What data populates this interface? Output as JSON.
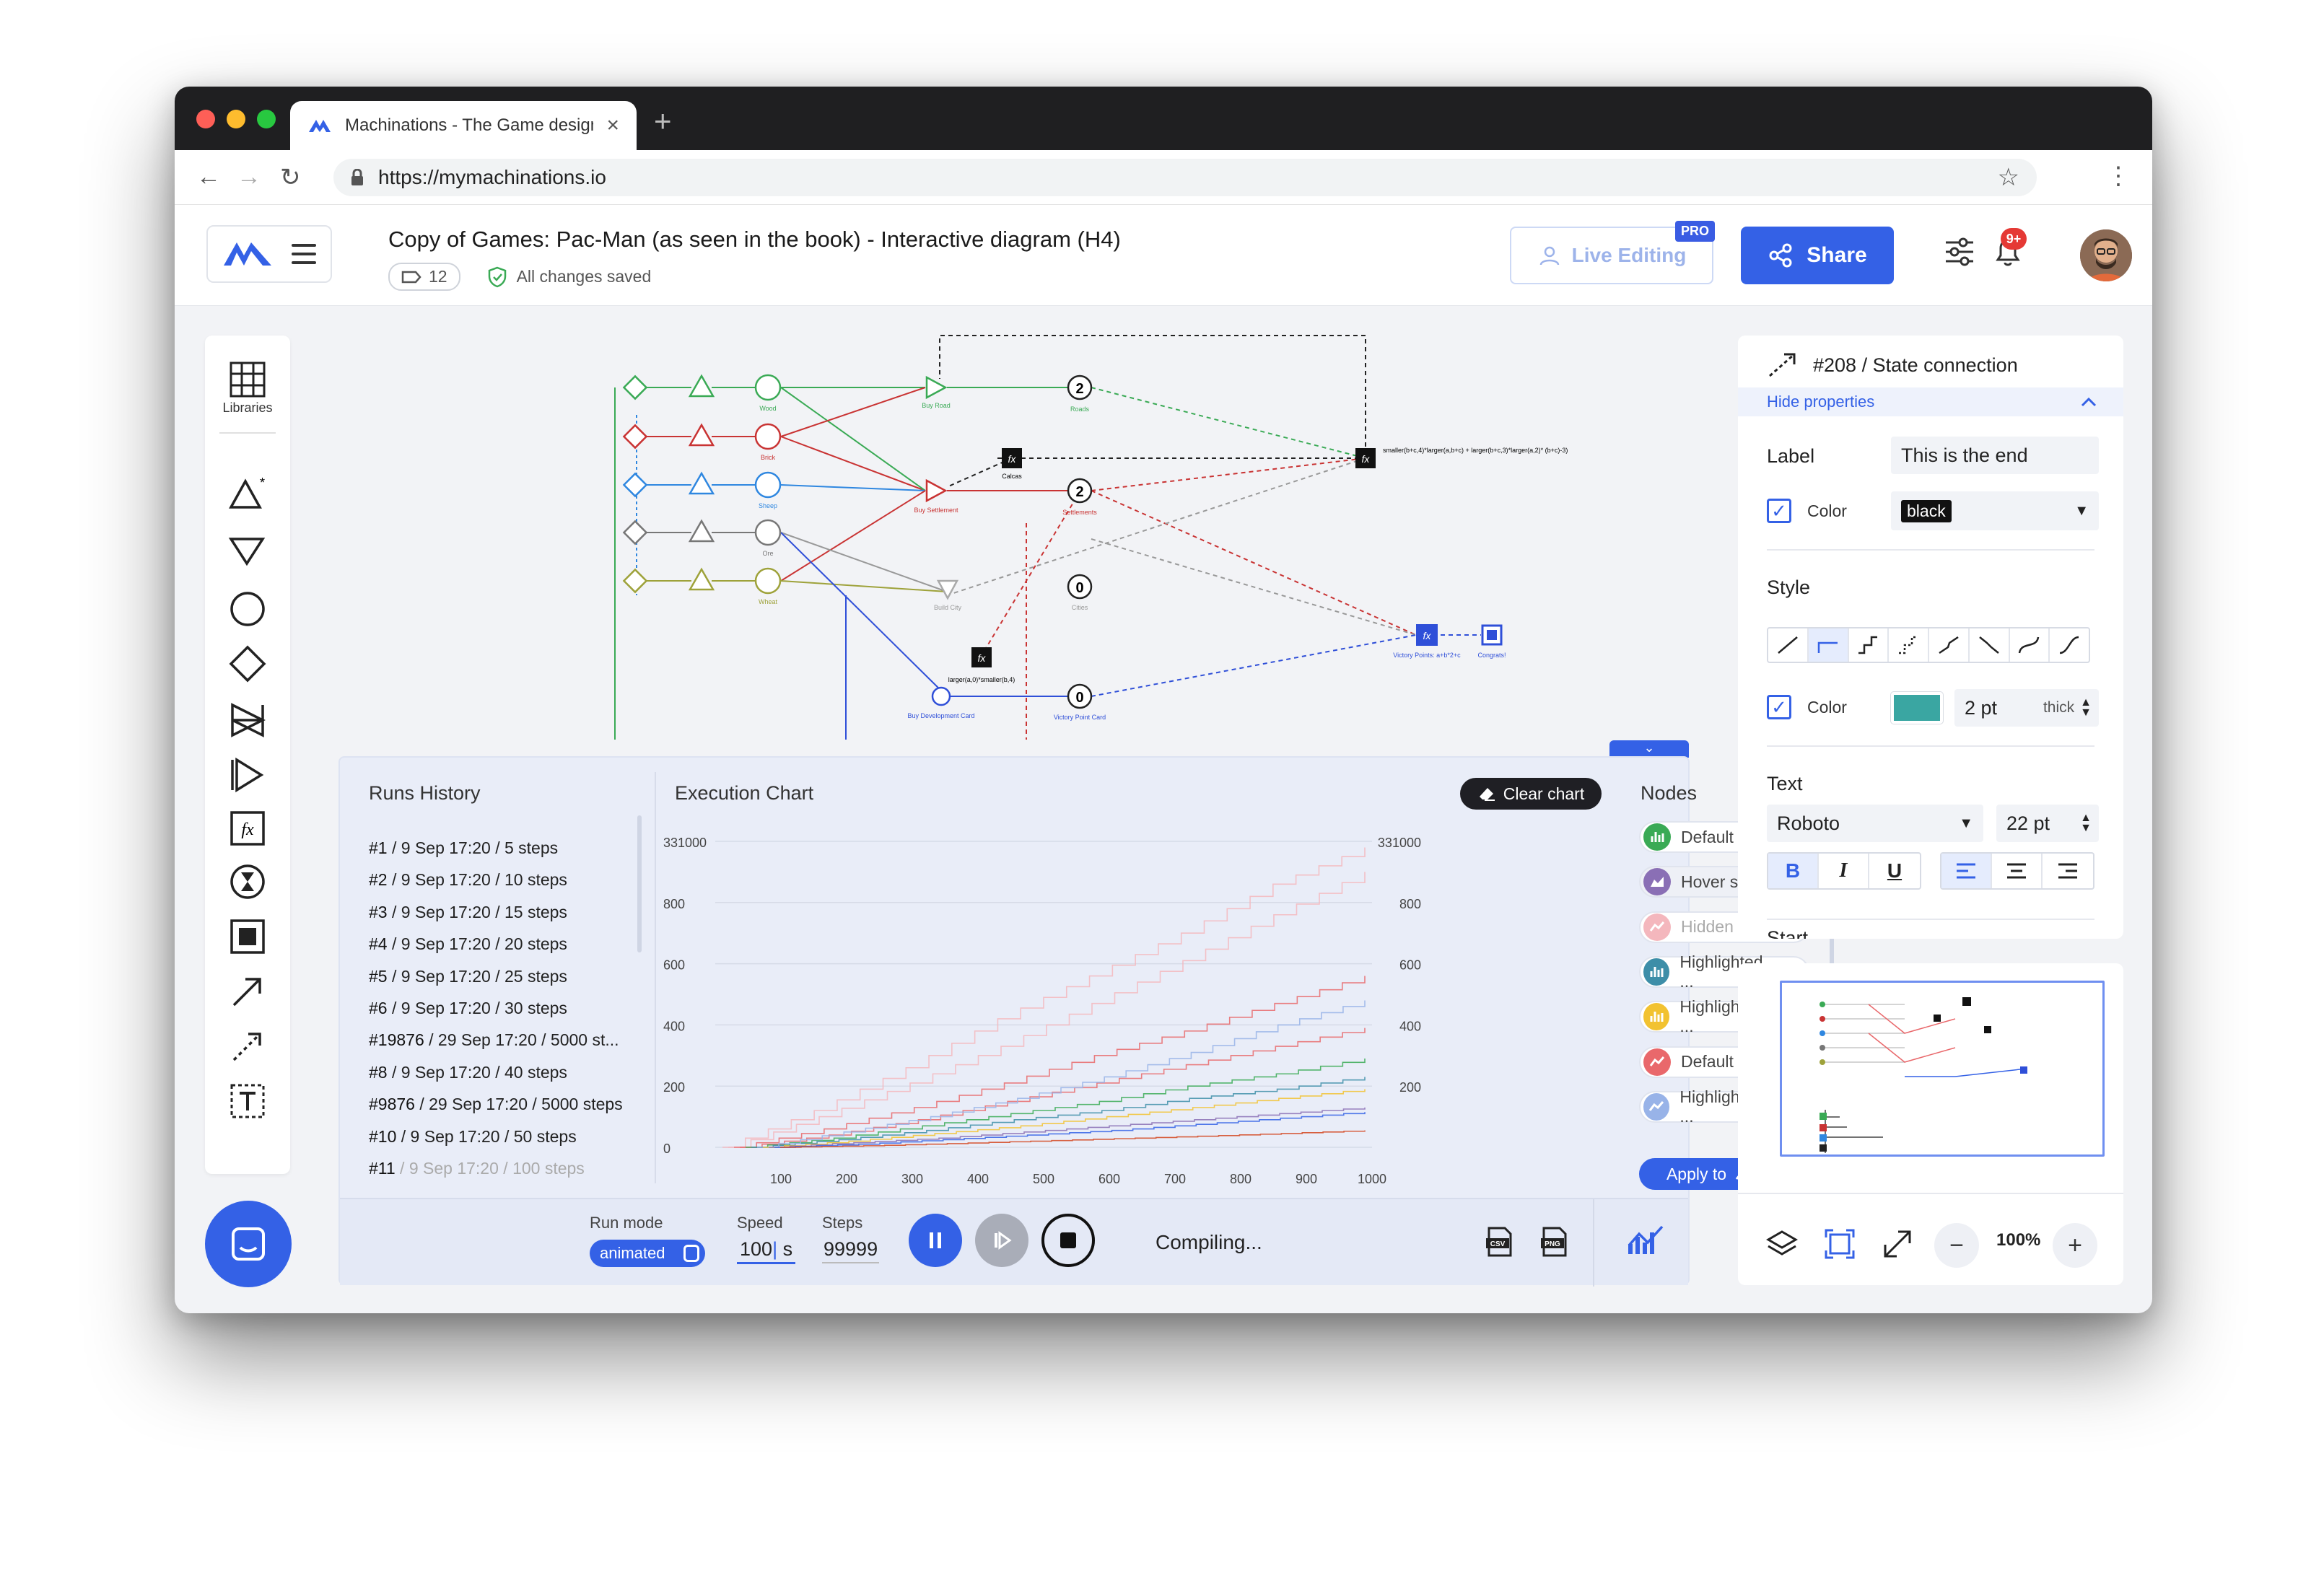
{
  "browser": {
    "tab_title": "Machinations - The Game design",
    "url": "https://mymachinations.io"
  },
  "header": {
    "doc_title": "Copy of Games: Pac-Man (as seen in the book) - Interactive diagram (H4)",
    "tag_count": "12",
    "save_status": "All changes saved",
    "live_editing_label": "Live Editing",
    "pro_badge": "PRO",
    "share_label": "Share",
    "notification_badge": "9+"
  },
  "toolbar": {
    "libraries_label": "Libraries",
    "tools": [
      "pool-icon",
      "drain-icon",
      "source-circle-icon",
      "gate-icon",
      "converter-icon",
      "trader-icon",
      "formula-icon",
      "delay-icon",
      "end-condition-icon",
      "resource-connection-icon",
      "state-connection-icon",
      "text-icon"
    ]
  },
  "diagram": {
    "node_labels": {
      "wood": "Wood",
      "brick": "Brick",
      "sheep": "Sheep",
      "ore": "Ore",
      "wheat": "Wheat",
      "buy_road": "Buy Road",
      "buy_settlement": "Buy Settlement",
      "build_city": "Build City",
      "buy_dev_card": "Buy Development Card",
      "roads": "Roads",
      "settlements": "Settlements",
      "cities": "Cities",
      "victory_points_card": "Victory Point Card",
      "victory_points": "Victory Points: a+b*2+c",
      "congrats": "Congrats!",
      "calc": "Calcas",
      "formula1": "smaller(b+c,4)*larger(a,b+c) + larger(b+c,3)*larger(a,2)* (b+c)-3)",
      "formula2": "larger(a,0)*smaller(b,4)"
    },
    "pool_values": {
      "roads": "2",
      "settlements": "2",
      "cities": "0",
      "vpcard": "0"
    }
  },
  "panel": {
    "runs_title": "Runs History",
    "runs": [
      {
        "id": "#1",
        "rest": " / 9 Sep 17:20 / 5 steps"
      },
      {
        "id": "#2",
        "rest": " / 9 Sep 17:20 / 10 steps"
      },
      {
        "id": "#3",
        "rest": " / 9 Sep 17:20 / 15 steps"
      },
      {
        "id": "#4",
        "rest": " / 9 Sep 17:20 / 20 steps"
      },
      {
        "id": "#5",
        "rest": " / 9 Sep 17:20 / 25 steps"
      },
      {
        "id": "#6",
        "rest": " / 9 Sep 17:20 / 30 steps"
      },
      {
        "id": "#19876",
        "rest": " / 29 Sep 17:20 / 5000 st..."
      },
      {
        "id": "#8",
        "rest": " / 9 Sep 17:20 / 40 steps"
      },
      {
        "id": "#9876",
        "rest": " / 29 Sep 17:20 / 5000 steps"
      },
      {
        "id": "#10",
        "rest": " / 9 Sep 17:20 / 50 steps"
      },
      {
        "id": "#11",
        "rest": " / 9 Sep 17:20 / 100 steps"
      }
    ],
    "chart_title": "Execution Chart",
    "clear_chart_label": "Clear chart",
    "nodes_title": "Nodes",
    "nodes": [
      {
        "label": "Default state",
        "color": "#3aaa55",
        "icon": "bar-chart-icon",
        "faded": false
      },
      {
        "label": "Hover state",
        "color": "#8a6fb5",
        "icon": "area-chart-icon",
        "faded": false
      },
      {
        "label": "Hidden state",
        "color": "#f4b7bd",
        "icon": "line-chart-icon",
        "faded": true
      },
      {
        "label": "Highlighted ...",
        "color": "#3d8ea8",
        "icon": "bar-chart-icon",
        "faded": false
      },
      {
        "label": "Highlighted ...",
        "color": "#f2c230",
        "icon": "bar-chart-icon",
        "faded": false
      },
      {
        "label": "Default state",
        "color": "#e9686b",
        "icon": "line-chart-icon",
        "faded": false
      },
      {
        "label": "Highlighted ...",
        "color": "#98b3e8",
        "icon": "line-chart-icon",
        "faded": false
      }
    ],
    "apply_label_prefix": "Apply to",
    "apply_label_suffix": "all",
    "run_mode_label": "Run mode",
    "run_mode_value": "animated",
    "speed_label": "Speed",
    "speed_value": "100",
    "speed_unit": "s",
    "steps_label": "Steps",
    "steps_value": "99999",
    "status": "Compiling...",
    "export_csv": "CSV",
    "export_png": "PNG"
  },
  "chart_data": {
    "type": "line",
    "title": "Execution Chart",
    "x_ticks": [
      "100",
      "200",
      "300",
      "400",
      "500",
      "600",
      "700",
      "800",
      "900",
      "1000"
    ],
    "y_ticks_left": [
      "0",
      "200",
      "400",
      "600",
      "800",
      "331000"
    ],
    "y_ticks_right": [
      "200",
      "400",
      "600",
      "800",
      "331000"
    ],
    "xlim": [
      0,
      1000
    ],
    "series": [
      {
        "color": "#f4b7bd",
        "values": [
          0,
          120,
          260,
          420,
          560,
          700,
          860,
          980
        ]
      },
      {
        "color": "#f4b7bd",
        "values": [
          0,
          100,
          210,
          330,
          470,
          610,
          760,
          900
        ]
      },
      {
        "color": "#e9686b",
        "values": [
          0,
          60,
          130,
          210,
          300,
          380,
          470,
          560
        ]
      },
      {
        "color": "#e9686b",
        "values": [
          0,
          40,
          90,
          150,
          210,
          270,
          330,
          390
        ]
      },
      {
        "color": "#3aaa55",
        "values": [
          0,
          30,
          70,
          110,
          150,
          200,
          240,
          290
        ]
      },
      {
        "color": "#3d8ea8",
        "values": [
          0,
          25,
          55,
          90,
          120,
          160,
          190,
          230
        ]
      },
      {
        "color": "#98b3e8",
        "values": [
          0,
          50,
          100,
          160,
          230,
          310,
          400,
          480
        ]
      },
      {
        "color": "#f2c230",
        "values": [
          0,
          20,
          45,
          70,
          100,
          130,
          160,
          190
        ]
      },
      {
        "color": "#8a6fb5",
        "values": [
          0,
          15,
          30,
          50,
          70,
          90,
          110,
          130
        ]
      },
      {
        "color": "#3461e6",
        "values": [
          0,
          10,
          25,
          40,
          55,
          75,
          95,
          115
        ]
      },
      {
        "color": "#d4451f",
        "values": [
          0,
          5,
          12,
          20,
          28,
          36,
          45,
          55
        ]
      }
    ],
    "grid": true
  },
  "properties": {
    "title": "#208 / State connection",
    "hide_label": "Hide properties",
    "label_label": "Label",
    "label_value": "This is the end",
    "color_label": "Color",
    "label_color_value": "black",
    "style_label": "Style",
    "line_color_hex": "#3aa6a2",
    "thickness_value": "2 pt",
    "thickness_type": "thick",
    "text_label": "Text",
    "font_value": "Roboto",
    "font_size": "22 pt",
    "bold": "B",
    "italic": "I",
    "underline": "U",
    "start_label": "Start"
  },
  "minimap": {
    "zoom": "100%"
  }
}
